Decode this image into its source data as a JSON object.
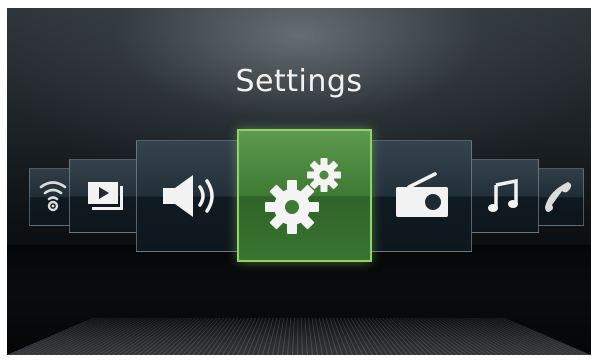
{
  "screen": {
    "title": "Settings"
  },
  "carousel": {
    "items": [
      {
        "name": "wifi",
        "icon": "wifi-icon"
      },
      {
        "name": "video",
        "icon": "video-player-icon"
      },
      {
        "name": "volume",
        "icon": "speaker-volume-icon"
      },
      {
        "name": "settings",
        "icon": "gears-icon",
        "selected": true
      },
      {
        "name": "radio",
        "icon": "radio-icon"
      },
      {
        "name": "music",
        "icon": "music-note-icon"
      },
      {
        "name": "phone",
        "icon": "phone-handset-icon"
      }
    ]
  },
  "colors": {
    "selected_tile": "#4e8a40",
    "selected_border": "#8fd36a",
    "icon": "#f2f2f2"
  }
}
